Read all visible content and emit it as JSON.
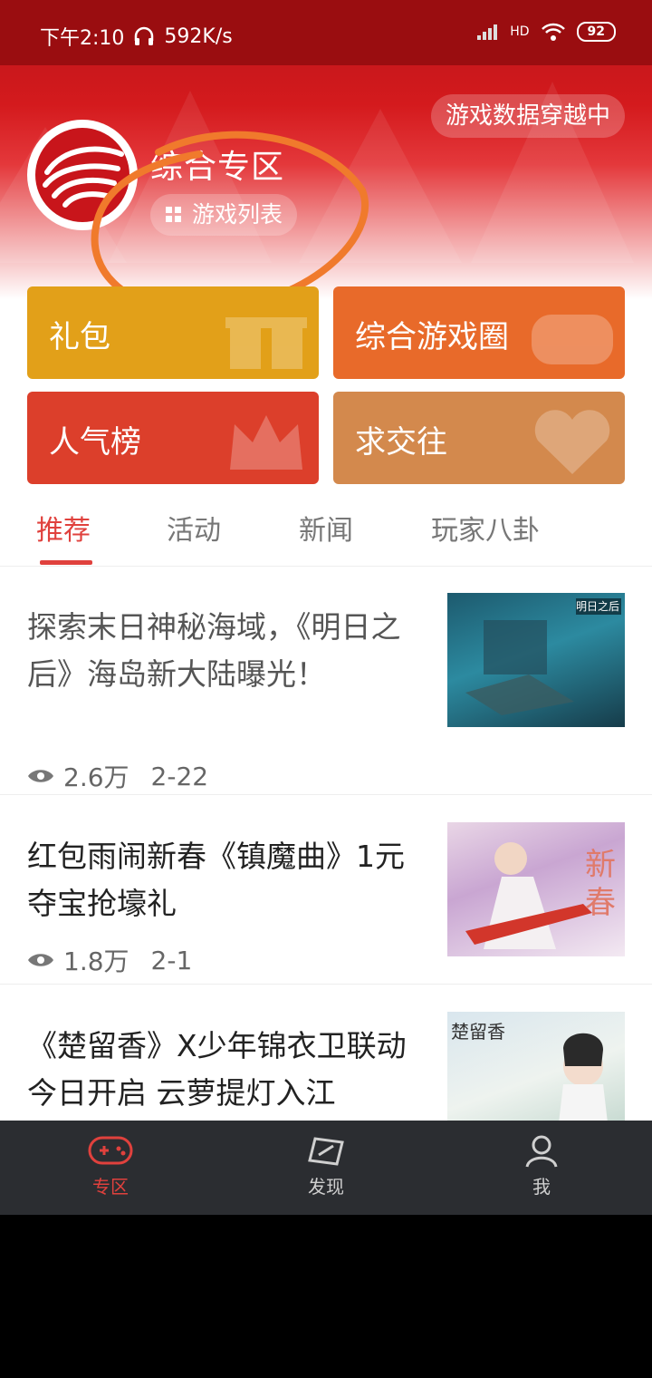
{
  "status": {
    "time": "下午2:10",
    "speed": "592K/s",
    "battery": "92",
    "signal_label": "HD"
  },
  "header": {
    "sync_label": "游戏数据穿越中",
    "zone_title": "综合专区",
    "game_list_label": "游戏列表"
  },
  "tiles": [
    {
      "label": "礼包",
      "color": "#e2a019"
    },
    {
      "label": "综合游戏圈",
      "color": "#e86a2a"
    },
    {
      "label": "人气榜",
      "color": "#dc3f2b"
    },
    {
      "label": "求交往",
      "color": "#d3894d"
    }
  ],
  "tabs": [
    {
      "label": "推荐",
      "active": true
    },
    {
      "label": "活动"
    },
    {
      "label": "新闻"
    },
    {
      "label": "玩家八卦"
    }
  ],
  "news": [
    {
      "title": "探索末日神秘海域，《明日之后》海岛新大陆曝光！",
      "views": "2.6万",
      "date": "2-22",
      "thumb_text": "明日之后"
    },
    {
      "title": "红包雨闹新春《镇魔曲》1元夺宝抢壕礼",
      "views": "1.8万",
      "date": "2-1",
      "thumb_text": "新春"
    },
    {
      "title": "《楚留香》X少年锦衣卫联动今日开启 云萝提灯入江",
      "thumb_text": "楚留香"
    }
  ],
  "nav": [
    {
      "label": "专区",
      "icon": "gamepad-icon",
      "active": true
    },
    {
      "label": "发现",
      "icon": "discover-icon"
    },
    {
      "label": "我",
      "icon": "person-icon"
    }
  ],
  "colors": {
    "accent": "#e0413d",
    "header_red": "#d41a1d",
    "nav_bg": "#2b2d31"
  }
}
